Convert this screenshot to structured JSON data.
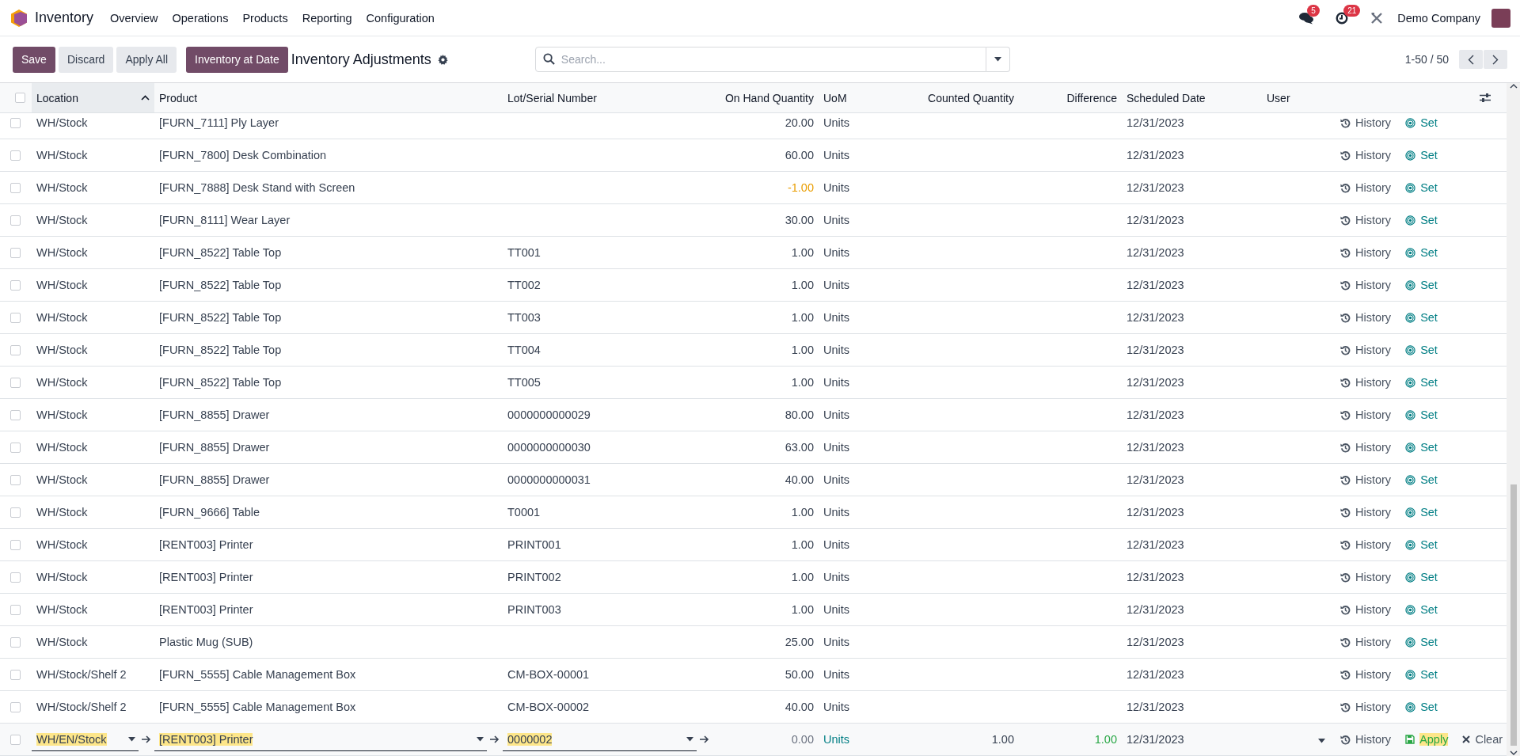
{
  "navbar": {
    "app": "Inventory",
    "menu": [
      "Overview",
      "Operations",
      "Products",
      "Reporting",
      "Configuration"
    ],
    "messages_badge": "5",
    "activities_badge": "21",
    "company": "Demo Company"
  },
  "control_panel": {
    "buttons": [
      {
        "label": "Save",
        "kind": "primary"
      },
      {
        "label": "Discard",
        "kind": "secondary"
      },
      {
        "label": "Apply All",
        "kind": "secondary"
      },
      {
        "label": "Inventory at Date",
        "kind": "primary"
      }
    ],
    "title": "Inventory Adjustments",
    "search": {
      "placeholder": "Search..."
    },
    "pager": "1-50 / 50"
  },
  "table": {
    "all_selected": false,
    "columns": [
      {
        "label": "Location",
        "sorted": true
      },
      {
        "label": "Product",
        "sorted": false
      },
      {
        "label": "Lot/Serial Number",
        "sorted": false
      },
      {
        "label": "On Hand Quantity",
        "sorted": false
      },
      {
        "label": "UoM",
        "sorted": false
      },
      {
        "label": "Counted Quantity",
        "sorted": false
      },
      {
        "label": "Difference",
        "sorted": false
      },
      {
        "label": "Scheduled Date",
        "sorted": false
      },
      {
        "label": "User",
        "sorted": false
      }
    ],
    "rows": [
      {
        "selected": false,
        "location": "WH/Stock",
        "product": "[FURN_7111] Ply Layer",
        "on_hand": "20.00",
        "negative": false,
        "uom": "Units",
        "date": "12/31/2023",
        "history": "History",
        "action": "Set"
      },
      {
        "selected": false,
        "location": "WH/Stock",
        "product": "[FURN_7800] Desk Combination",
        "on_hand": "60.00",
        "negative": false,
        "uom": "Units",
        "date": "12/31/2023",
        "history": "History",
        "action": "Set"
      },
      {
        "selected": false,
        "location": "WH/Stock",
        "product": "[FURN_7888] Desk Stand with Screen",
        "on_hand": "-1.00",
        "negative": true,
        "uom": "Units",
        "date": "12/31/2023",
        "history": "History",
        "action": "Set"
      },
      {
        "selected": false,
        "location": "WH/Stock",
        "product": "[FURN_8111] Wear Layer",
        "on_hand": "30.00",
        "negative": false,
        "uom": "Units",
        "date": "12/31/2023",
        "history": "History",
        "action": "Set"
      },
      {
        "selected": false,
        "location": "WH/Stock",
        "product": "[FURN_8522] Table Top",
        "lot": "TT001",
        "on_hand": "1.00",
        "negative": false,
        "uom": "Units",
        "date": "12/31/2023",
        "history": "History",
        "action": "Set"
      },
      {
        "selected": false,
        "location": "WH/Stock",
        "product": "[FURN_8522] Table Top",
        "lot": "TT002",
        "on_hand": "1.00",
        "negative": false,
        "uom": "Units",
        "date": "12/31/2023",
        "history": "History",
        "action": "Set"
      },
      {
        "selected": false,
        "location": "WH/Stock",
        "product": "[FURN_8522] Table Top",
        "lot": "TT003",
        "on_hand": "1.00",
        "negative": false,
        "uom": "Units",
        "date": "12/31/2023",
        "history": "History",
        "action": "Set"
      },
      {
        "selected": false,
        "location": "WH/Stock",
        "product": "[FURN_8522] Table Top",
        "lot": "TT004",
        "on_hand": "1.00",
        "negative": false,
        "uom": "Units",
        "date": "12/31/2023",
        "history": "History",
        "action": "Set"
      },
      {
        "selected": false,
        "location": "WH/Stock",
        "product": "[FURN_8522] Table Top",
        "lot": "TT005",
        "on_hand": "1.00",
        "negative": false,
        "uom": "Units",
        "date": "12/31/2023",
        "history": "History",
        "action": "Set"
      },
      {
        "selected": false,
        "location": "WH/Stock",
        "product": "[FURN_8855] Drawer",
        "lot": "0000000000029",
        "on_hand": "80.00",
        "negative": false,
        "uom": "Units",
        "date": "12/31/2023",
        "history": "History",
        "action": "Set"
      },
      {
        "selected": false,
        "location": "WH/Stock",
        "product": "[FURN_8855] Drawer",
        "lot": "0000000000030",
        "on_hand": "63.00",
        "negative": false,
        "uom": "Units",
        "date": "12/31/2023",
        "history": "History",
        "action": "Set"
      },
      {
        "selected": false,
        "location": "WH/Stock",
        "product": "[FURN_8855] Drawer",
        "lot": "0000000000031",
        "on_hand": "40.00",
        "negative": false,
        "uom": "Units",
        "date": "12/31/2023",
        "history": "History",
        "action": "Set"
      },
      {
        "selected": false,
        "location": "WH/Stock",
        "product": "[FURN_9666] Table",
        "lot": "T0001",
        "on_hand": "1.00",
        "negative": false,
        "uom": "Units",
        "date": "12/31/2023",
        "history": "History",
        "action": "Set"
      },
      {
        "selected": false,
        "location": "WH/Stock",
        "product": "[RENT003] Printer",
        "lot": "PRINT001",
        "on_hand": "1.00",
        "negative": false,
        "uom": "Units",
        "date": "12/31/2023",
        "history": "History",
        "action": "Set"
      },
      {
        "selected": false,
        "location": "WH/Stock",
        "product": "[RENT003] Printer",
        "lot": "PRINT002",
        "on_hand": "1.00",
        "negative": false,
        "uom": "Units",
        "date": "12/31/2023",
        "history": "History",
        "action": "Set"
      },
      {
        "selected": false,
        "location": "WH/Stock",
        "product": "[RENT003] Printer",
        "lot": "PRINT003",
        "on_hand": "1.00",
        "negative": false,
        "uom": "Units",
        "date": "12/31/2023",
        "history": "History",
        "action": "Set"
      },
      {
        "selected": false,
        "location": "WH/Stock",
        "product": "Plastic Mug (SUB)",
        "on_hand": "25.00",
        "negative": false,
        "uom": "Units",
        "date": "12/31/2023",
        "history": "History",
        "action": "Set"
      },
      {
        "selected": false,
        "location": "WH/Stock/Shelf 2",
        "product": "[FURN_5555] Cable Management Box",
        "lot": "CM-BOX-00001",
        "on_hand": "50.00",
        "negative": false,
        "uom": "Units",
        "date": "12/31/2023",
        "history": "History",
        "action": "Set"
      },
      {
        "selected": false,
        "location": "WH/Stock/Shelf 2",
        "product": "[FURN_5555] Cable Management Box",
        "lot": "CM-BOX-00002",
        "on_hand": "40.00",
        "negative": false,
        "uom": "Units",
        "date": "12/31/2023",
        "history": "History",
        "action": "Set"
      }
    ],
    "edit_row": {
      "selected": false,
      "location": {
        "value": "WH/EN/Stock",
        "highlighted": true
      },
      "product": {
        "value": "[RENT003] Printer",
        "highlighted": true
      },
      "lot": {
        "value": "0000002",
        "highlighted": true
      },
      "on_hand": "0.00",
      "uom": "Units",
      "counted": "1.00",
      "difference": "1.00",
      "date": "12/31/2023",
      "history": "History",
      "apply": {
        "label": "Apply",
        "highlighted": true
      },
      "clear": "Clear"
    }
  }
}
